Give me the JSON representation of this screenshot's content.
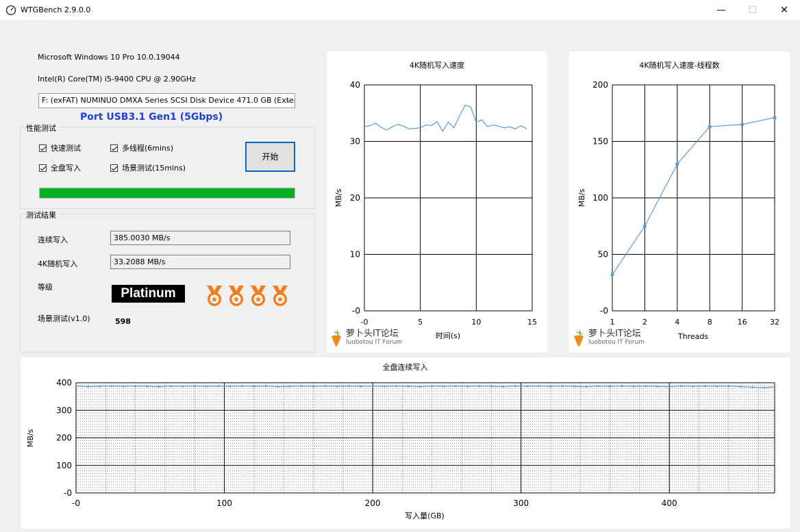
{
  "window": {
    "title": "WTGBench 2.9.0.0",
    "controls": {
      "minimize": "—",
      "maximize": "☐",
      "close": "✕"
    }
  },
  "system": {
    "os": "Microsoft Windows 10 Pro 10.0.19044",
    "cpu": "Intel(R) Core(TM) i5-9400 CPU @ 2.90GHz"
  },
  "disk_select": {
    "value": "F:  (exFAT) NUMINUO DMXA Series SCSI Disk Device 471.0 GB (Exter"
  },
  "port_info": "Port USB3.1 Gen1 (5Gbps)",
  "perf_test": {
    "group_title": "性能测试",
    "quick_test": "快速测试",
    "full_write": "全盘写入",
    "multithread": "多线程(6mins)",
    "scene_test": "场景测试(15mins)",
    "start_button": "开始",
    "progress_pct": 100
  },
  "results": {
    "group_title": "测试结果",
    "seq_write_label": "连续写入",
    "seq_write_value": "385.0030 MB/s",
    "rand4k_label": "4K随机写入",
    "rand4k_value": "33.2088 MB/s",
    "grade_label": "等级",
    "grade_value": "Platinum",
    "scene_label": "场景测试(v1.0)",
    "scene_value": "598",
    "medals": 4
  },
  "watermark": {
    "name": "萝卜头IT论坛",
    "sub": "luobotou IT Forum"
  },
  "colors": {
    "series": "#5b9bd5",
    "progress": "#06b025",
    "port": "#1f3fd6",
    "medal": "#f07d1e"
  },
  "chart_data": [
    {
      "type": "line",
      "title": "4K随机写入速度",
      "xlabel": "时间(s)",
      "ylabel": "MB/s",
      "xlim": [
        0,
        15
      ],
      "ylim": [
        0,
        40
      ],
      "xticks": [
        "-0",
        "5",
        "10",
        "15"
      ],
      "yticks": [
        "-0",
        "10",
        "20",
        "30",
        "40"
      ],
      "grid": true,
      "x": [
        0,
        0.5,
        1,
        1.5,
        2,
        2.5,
        3,
        3.5,
        4,
        4.5,
        5,
        5.5,
        6,
        6.5,
        7,
        7.5,
        8,
        8.5,
        9,
        9.5,
        10,
        10.5,
        11,
        11.5,
        12,
        12.5,
        13,
        13.5,
        14,
        14.5
      ],
      "y": [
        32.6,
        32.8,
        33.2,
        32.5,
        32.0,
        32.6,
        33.0,
        32.7,
        32.2,
        32.3,
        32.4,
        32.9,
        32.8,
        33.5,
        31.8,
        33.4,
        32.4,
        34.5,
        36.4,
        36.1,
        33.4,
        33.8,
        32.6,
        32.9,
        32.7,
        32.4,
        32.6,
        32.2,
        32.8,
        32.2
      ]
    },
    {
      "type": "line",
      "title": "4K随机写入速度-线程数",
      "xlabel": "Threads",
      "ylabel": "MB/s",
      "ylim": [
        0,
        200
      ],
      "categories": [
        "1",
        "2",
        "4",
        "8",
        "16",
        "32"
      ],
      "yticks": [
        "-0",
        "50",
        "100",
        "150",
        "200"
      ],
      "grid": true,
      "values": [
        32,
        75,
        130,
        163,
        165,
        171
      ]
    },
    {
      "type": "line",
      "title": "全盘连续写入",
      "xlabel": "写入量(GB)",
      "ylabel": "MB/s",
      "xlim": [
        0,
        471
      ],
      "ylim": [
        0,
        400
      ],
      "xticks": [
        "-0",
        "100",
        "200",
        "300",
        "400"
      ],
      "yticks": [
        "-0",
        "100",
        "200",
        "300",
        "400"
      ],
      "grid": true,
      "x": [
        0,
        8,
        16,
        24,
        32,
        40,
        48,
        56,
        64,
        72,
        80,
        88,
        96,
        104,
        112,
        120,
        128,
        136,
        144,
        152,
        160,
        168,
        176,
        184,
        192,
        200,
        208,
        216,
        224,
        232,
        240,
        248,
        256,
        264,
        272,
        280,
        288,
        296,
        304,
        312,
        320,
        328,
        336,
        344,
        352,
        360,
        368,
        376,
        384,
        392,
        400,
        408,
        416,
        424,
        432,
        440,
        448,
        456,
        464,
        471
      ],
      "y": [
        388,
        386,
        387,
        388,
        387,
        388,
        387,
        386,
        388,
        387,
        388,
        387,
        388,
        387,
        388,
        387,
        388,
        386,
        387,
        388,
        387,
        388,
        387,
        388,
        387,
        388,
        387,
        388,
        387,
        386,
        388,
        387,
        388,
        387,
        388,
        387,
        386,
        388,
        387,
        388,
        387,
        388,
        387,
        386,
        388,
        387,
        388,
        387,
        388,
        387,
        386,
        388,
        387,
        388,
        387,
        388,
        386,
        384,
        382,
        385
      ]
    }
  ]
}
